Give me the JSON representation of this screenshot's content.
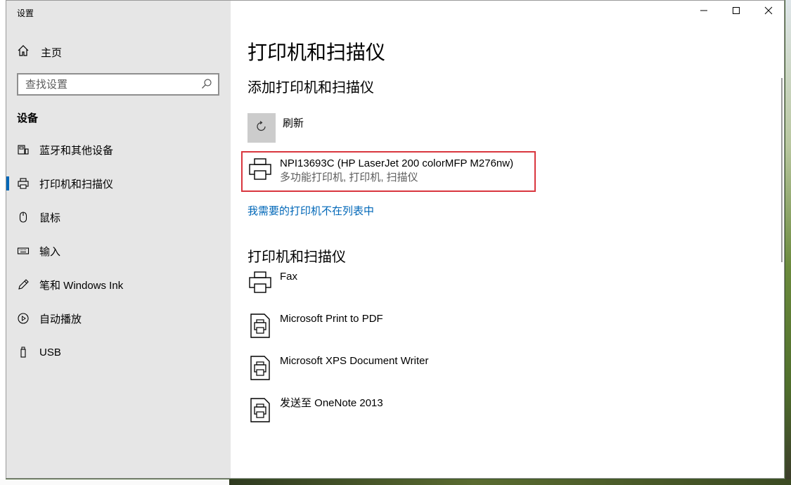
{
  "window": {
    "title": "设置"
  },
  "sidebar": {
    "home_label": "主页",
    "search_placeholder": "查找设置",
    "section_title": "设备",
    "items": [
      {
        "label": "蓝牙和其他设备",
        "icon": "bluetooth-devices-icon"
      },
      {
        "label": "打印机和扫描仪",
        "icon": "printer-icon"
      },
      {
        "label": "鼠标",
        "icon": "mouse-icon"
      },
      {
        "label": "输入",
        "icon": "keyboard-icon"
      },
      {
        "label": "笔和 Windows Ink",
        "icon": "pen-icon"
      },
      {
        "label": "自动播放",
        "icon": "autoplay-icon"
      },
      {
        "label": "USB",
        "icon": "usb-icon"
      }
    ],
    "active_index": 1
  },
  "main": {
    "page_title": "打印机和扫描仪",
    "add_section_title": "添加打印机和扫描仪",
    "refresh_label": "刷新",
    "found_device": {
      "name": "NPI13693C (HP LaserJet 200 colorMFP M276nw)",
      "description": "多功能打印机, 打印机, 扫描仪"
    },
    "not_listed_link": "我需要的打印机不在列表中",
    "printers_section_title": "打印机和扫描仪",
    "printers": [
      {
        "name": "Fax",
        "icon": "printer-icon"
      },
      {
        "name": "Microsoft Print to PDF",
        "icon": "document-printer-icon"
      },
      {
        "name": "Microsoft XPS Document Writer",
        "icon": "document-printer-icon"
      },
      {
        "name": "发送至 OneNote 2013",
        "icon": "document-printer-icon"
      }
    ]
  },
  "colors": {
    "accent": "#0067b8",
    "highlight_border": "#d9363e",
    "sidebar_bg": "#e6e6e6"
  }
}
